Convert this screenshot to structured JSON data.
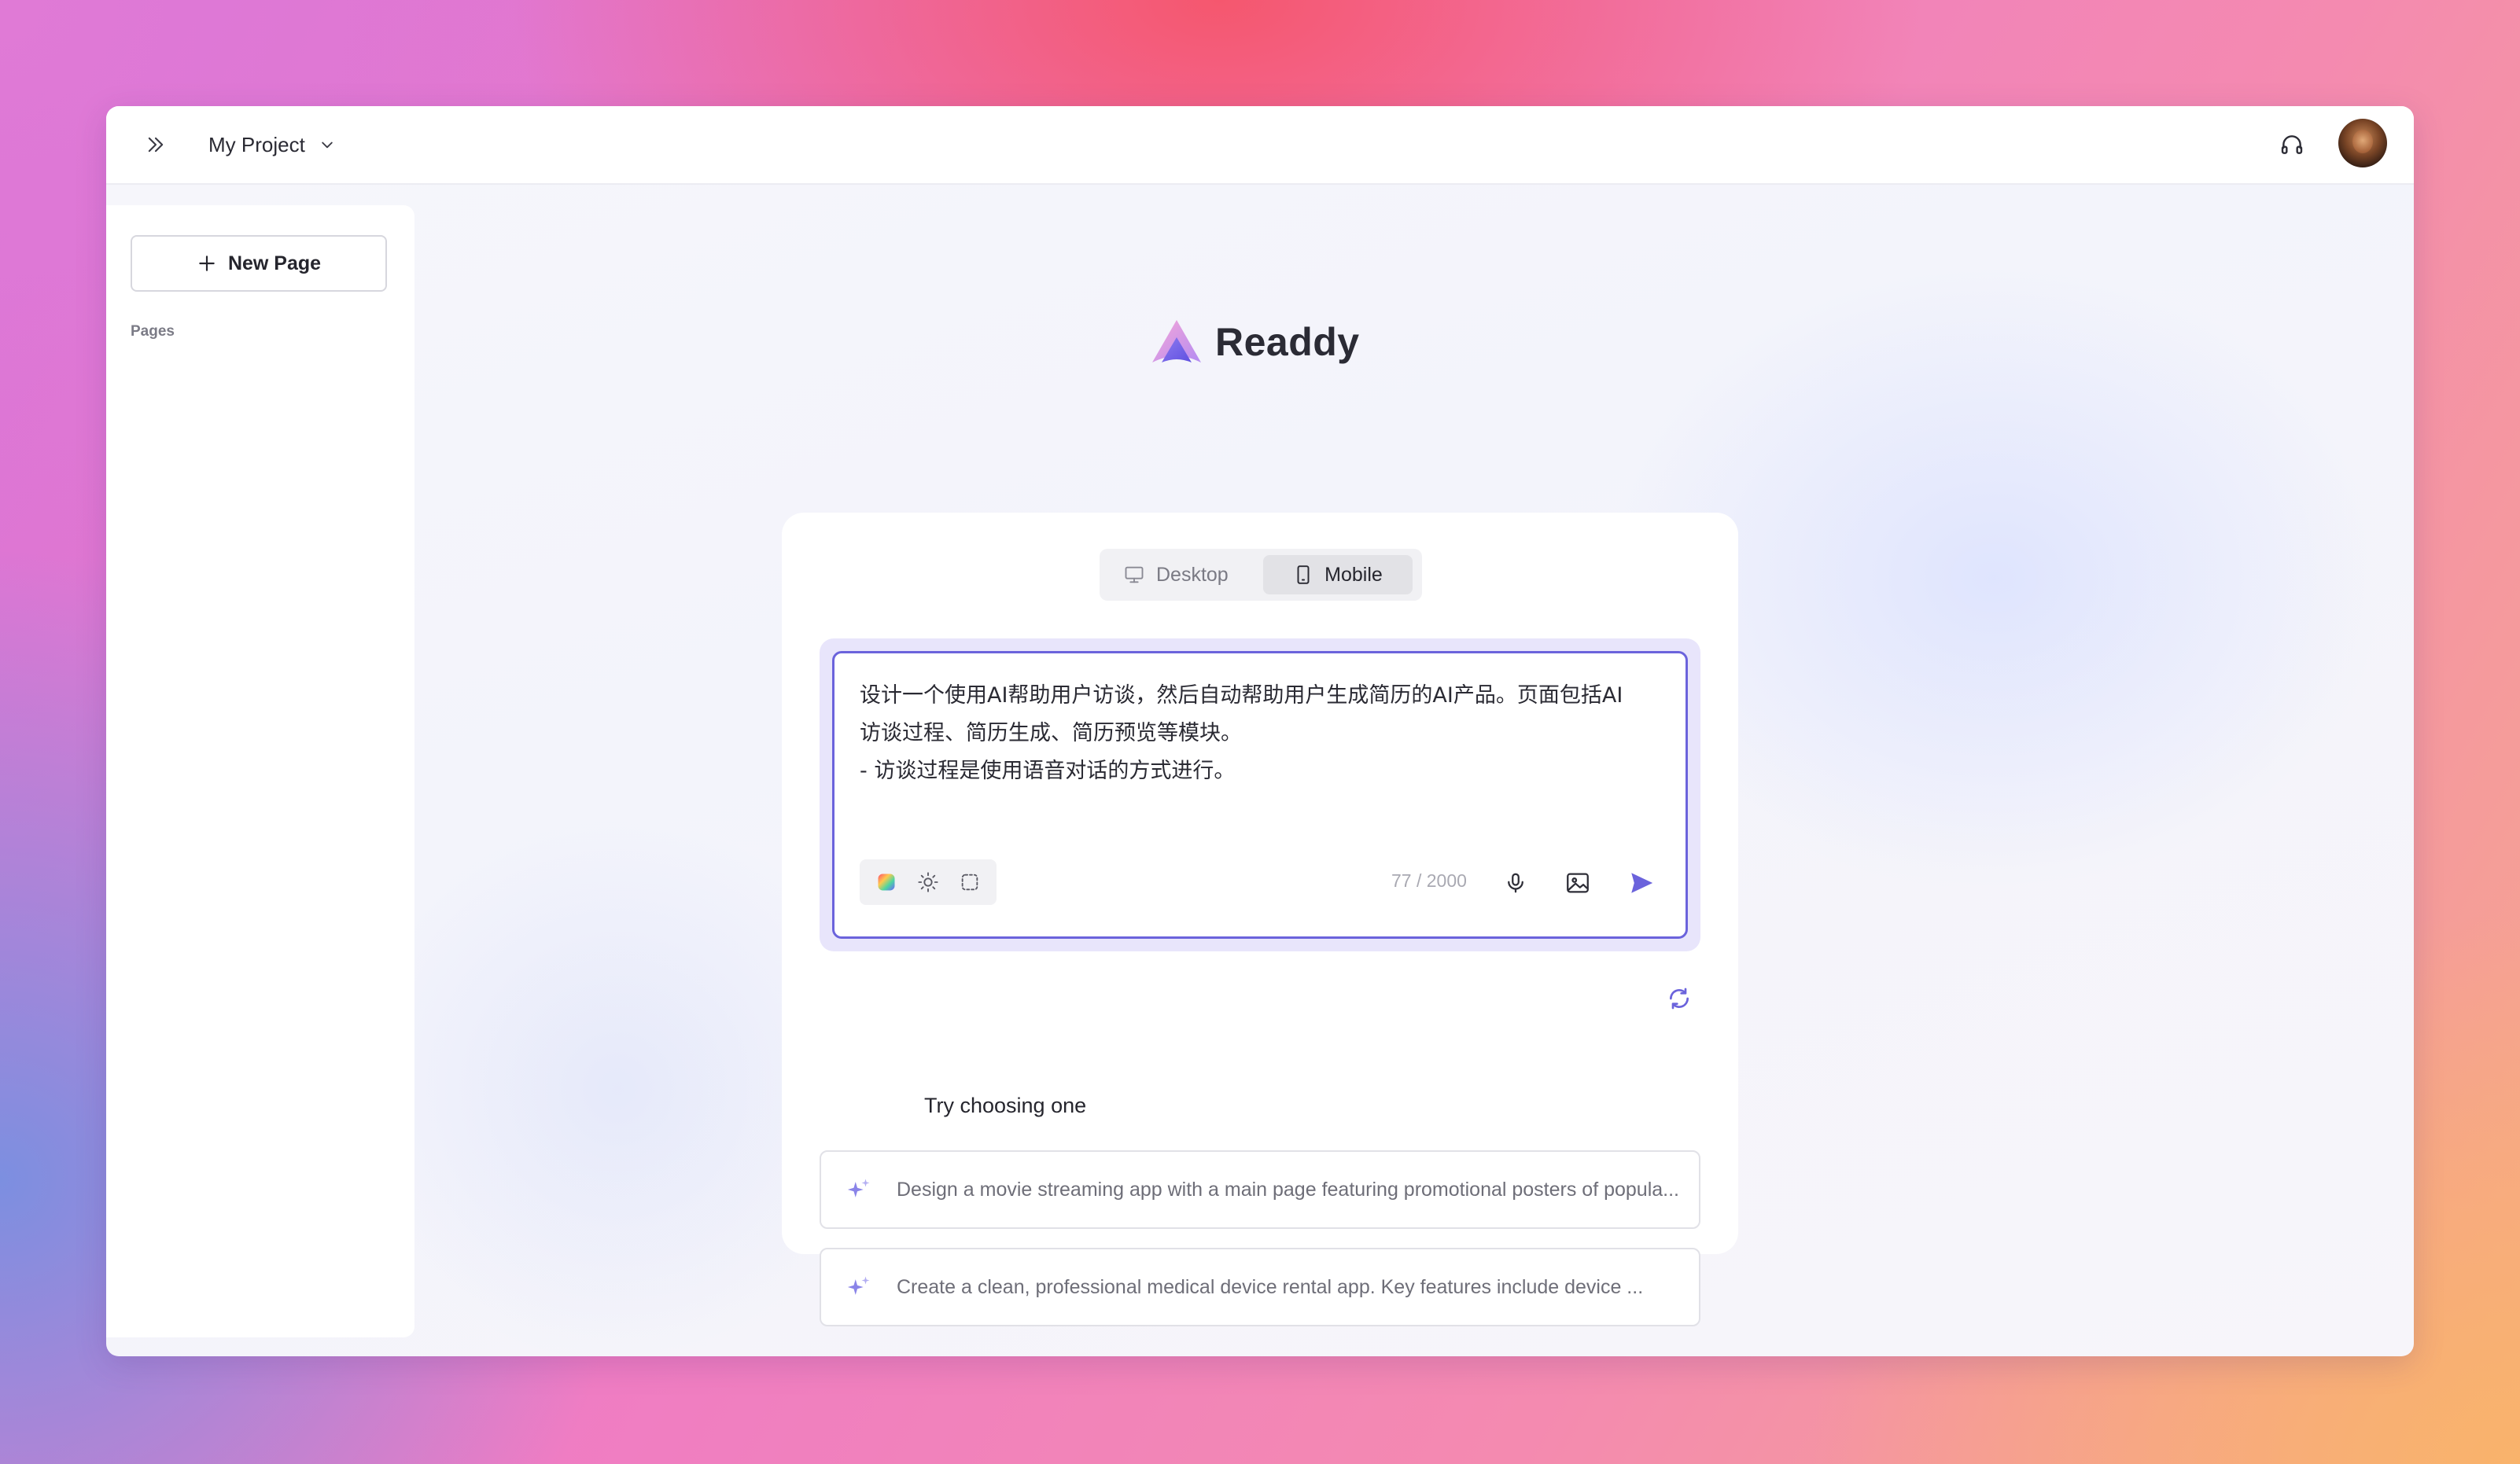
{
  "topbar": {
    "project_name": "My Project"
  },
  "sidebar": {
    "new_page_label": "New Page",
    "pages_label": "Pages"
  },
  "brand": {
    "name": "Readdy",
    "accent": "#6b63dc"
  },
  "device_toggle": {
    "options": [
      {
        "label": "Desktop",
        "icon": "monitor-icon",
        "selected": false
      },
      {
        "label": "Mobile",
        "icon": "smartphone-icon",
        "selected": true
      }
    ]
  },
  "prompt": {
    "text": "设计一个使用AI帮助用户访谈，然后自动帮助用户生成简历的AI产品。页面包括AI\n访谈过程、简历生成、简历预览等模块。\n- 访谈过程是使用语音对话的方式进行。",
    "counter": "77 / 2000",
    "tools": [
      "palette-icon",
      "sun-icon",
      "frame-icon"
    ]
  },
  "suggestions": {
    "title": "Try choosing one",
    "items": [
      "Design a movie streaming app with a main page featuring promotional posters of popula...",
      "Create a clean, professional medical device rental app. Key features include device ..."
    ]
  }
}
